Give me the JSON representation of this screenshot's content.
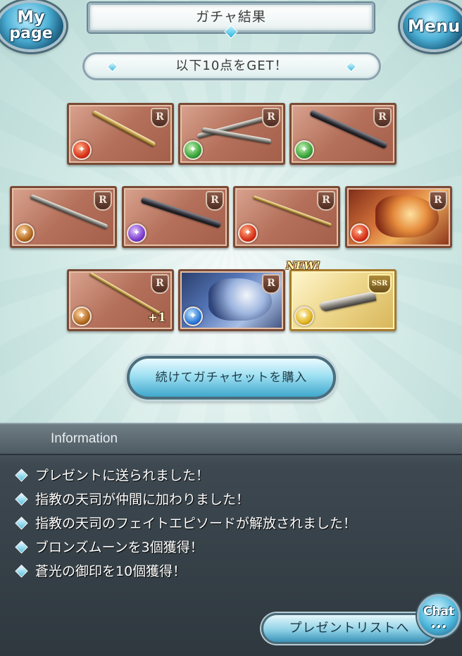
{
  "header": {
    "title": "ガチャ結果",
    "mypage_line1": "My",
    "mypage_line2": "page",
    "menu_label": "Menu"
  },
  "result": {
    "summary": "以下10点をGET！",
    "new_badge": "NEW!",
    "items": [
      {
        "rarity": "R",
        "element": "fire",
        "element_icon": "fire-element-icon",
        "kind": "weapon"
      },
      {
        "rarity": "R",
        "element": "wind",
        "element_icon": "wind-element-icon",
        "kind": "weapon"
      },
      {
        "rarity": "R",
        "element": "wind",
        "element_icon": "wind-element-icon",
        "kind": "weapon"
      },
      {
        "rarity": "R",
        "element": "earth",
        "element_icon": "earth-element-icon",
        "kind": "weapon"
      },
      {
        "rarity": "R",
        "element": "dark",
        "element_icon": "dark-element-icon",
        "kind": "weapon"
      },
      {
        "rarity": "R",
        "element": "fire",
        "element_icon": "fire-element-icon",
        "kind": "weapon"
      },
      {
        "rarity": "R",
        "element": "fire",
        "element_icon": "fire-element-icon",
        "kind": "summon"
      },
      {
        "rarity": "R",
        "element": "earth",
        "element_icon": "earth-element-icon",
        "kind": "weapon",
        "plus": "+1"
      },
      {
        "rarity": "R",
        "element": "water",
        "element_icon": "water-element-icon",
        "kind": "summon"
      },
      {
        "rarity": "SSR",
        "element": "light",
        "element_icon": "light-element-icon",
        "kind": "weapon",
        "is_new": true
      }
    ]
  },
  "buy_button": "続けてガチャセットを購入",
  "information": {
    "title": "Information",
    "messages": [
      "プレゼントに送られました！",
      "指教の天司が仲間に加わりました！",
      "指教の天司のフェイトエピソードが解放されました！",
      "ブロンズムーンを3個獲得！",
      "蒼光の御印を10個獲得！"
    ],
    "present_list_button": "プレゼントリストへ",
    "chat_button": "Chat",
    "chat_dots": "•••"
  }
}
